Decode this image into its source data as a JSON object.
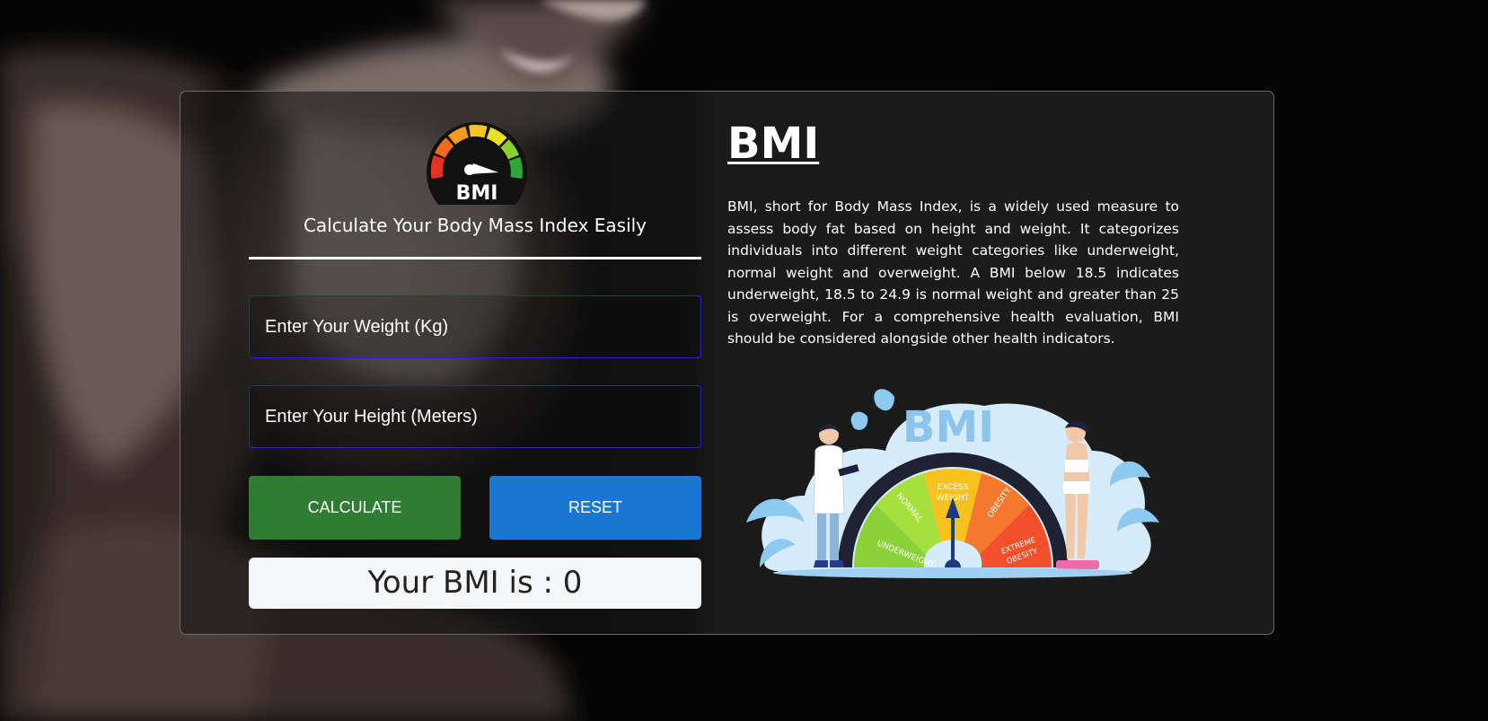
{
  "logo": {
    "icon": "bmi-gauge-icon",
    "text": "BMI"
  },
  "calculator": {
    "tagline": "Calculate Your Body Mass Index Easily",
    "weight_placeholder": "Enter Your Weight (Kg)",
    "height_placeholder": "Enter Your Height (Meters)",
    "weight_value": "",
    "height_value": "",
    "calculate_label": "CALCULATE",
    "reset_label": "RESET",
    "result_text": "Your BMI is : 0"
  },
  "info": {
    "title": "BMI",
    "description": "BMI, short for Body Mass Index, is a widely used measure to assess body fat based on height and weight. It categorizes individuals into different weight categories like underweight, normal weight and overweight. A BMI below 18.5 indicates underweight, 18.5 to 24.9 is normal weight and greater than 25 is overweight. For a comprehensive health evaluation, BMI should be considered alongside other health indicators."
  },
  "illustration": {
    "title": "BMI",
    "categories": [
      "UNDERWEIGHT",
      "NORMAL",
      "EXCESS",
      "WEIGHT",
      "OBESITY",
      "EXTREME",
      "OBESITY"
    ]
  },
  "colors": {
    "calculate": "#2e7d32",
    "reset": "#1976d2",
    "input_border": "#1f28c4",
    "underweight": "#8bd13a",
    "normal": "#a6e03c",
    "excess": "#f9c11d",
    "obesity": "#f4792e",
    "extreme": "#f2502a"
  }
}
